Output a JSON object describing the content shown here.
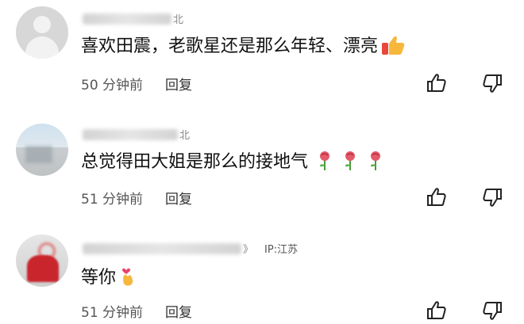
{
  "comments": [
    {
      "username_tail": "北",
      "text": "喜欢田震，老歌星还是那么年轻、漂亮",
      "emoji": "thumbs-up",
      "time": "50 分钟前",
      "reply_label": "回复"
    },
    {
      "username_tail": "北",
      "text": "总觉得田大姐是那么的接地气",
      "emoji": "rose",
      "time": "51 分钟前",
      "reply_label": "回复"
    },
    {
      "username_tail": "》",
      "ip": "IP:江苏",
      "text": "等你",
      "emoji": "finger-heart",
      "time": "51 分钟前",
      "reply_label": "回复"
    }
  ],
  "icons": {
    "like": "thumbs-up-outline-icon",
    "dislike": "thumbs-down-outline-icon"
  },
  "colors": {
    "text": "#111111",
    "meta": "#555555",
    "placeholder_avatar": "#d7d7d7"
  }
}
